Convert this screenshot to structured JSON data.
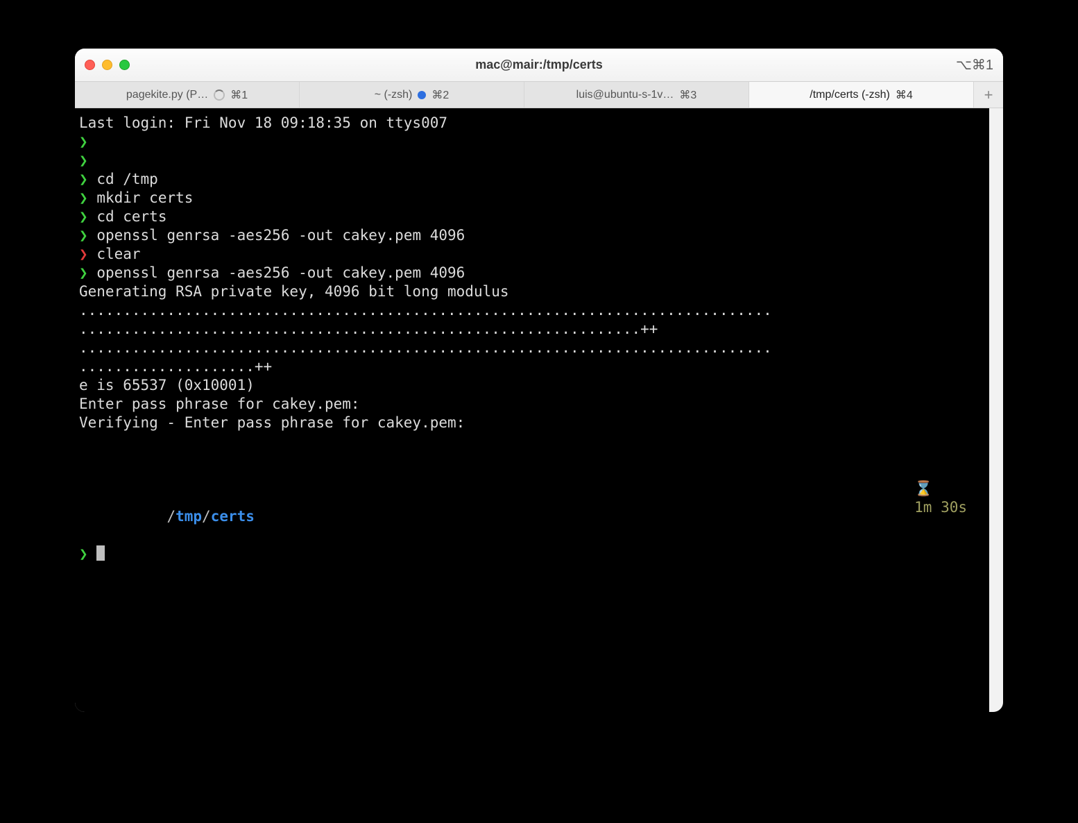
{
  "window": {
    "title": "mac@mair:/tmp/certs",
    "titlebar_shortcut": "⌥⌘1"
  },
  "tabs": [
    {
      "label": "pagekite.py (P…",
      "shortcut": "⌘1",
      "spinner": true
    },
    {
      "label": "~ (-zsh)",
      "shortcut": "⌘2",
      "bluedot": true
    },
    {
      "label": "luis@ubuntu-s-1v…",
      "shortcut": "⌘3"
    },
    {
      "label": "/tmp/certs (-zsh)",
      "shortcut": "⌘4",
      "active": true
    }
  ],
  "terminal": {
    "last_login": "Last login: Fri Nov 18 09:18:35 on ttys007",
    "cmds": {
      "cd_tmp": "cd /tmp",
      "mkdir": "mkdir certs",
      "cd_certs": "cd certs",
      "openssl1": "openssl genrsa -aes256 -out cakey.pem 4096",
      "clear": "clear",
      "openssl2": "openssl genrsa -aes256 -out cakey.pem 4096"
    },
    "out": {
      "gen": "Generating RSA private key, 4096 bit long modulus",
      "dots1": "...............................................................................",
      "dots2": "................................................................++",
      "dots3": "...............................................................................",
      "dots4": "....................++",
      "e": "e is 65537 (0x10001)",
      "enter": "Enter pass phrase for cakey.pem:",
      "verify": "Verifying - Enter pass phrase for cakey.pem:"
    },
    "prompt_path": {
      "slash1": "/",
      "tmp": "tmp",
      "slash2": "/",
      "certs": "certs"
    },
    "timer": "1m 30s"
  }
}
